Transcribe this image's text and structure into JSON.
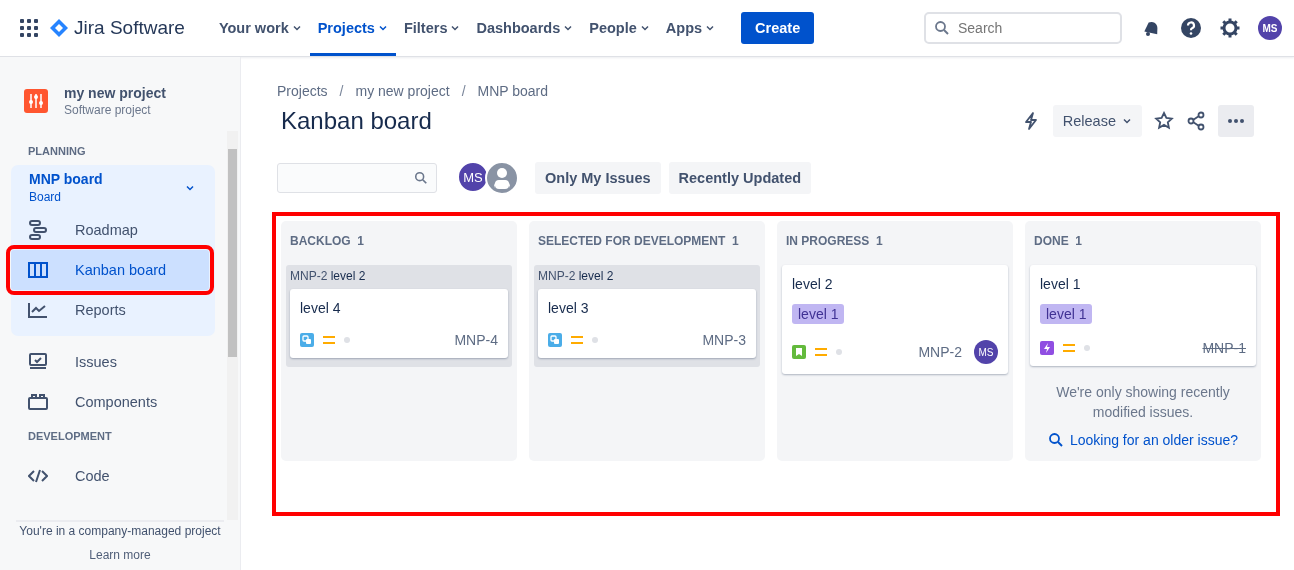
{
  "topnav": {
    "app_name": "Jira Software",
    "items": [
      {
        "label": "Your work",
        "selected": false
      },
      {
        "label": "Projects",
        "selected": true
      },
      {
        "label": "Filters",
        "selected": false
      },
      {
        "label": "Dashboards",
        "selected": false
      },
      {
        "label": "People",
        "selected": false
      },
      {
        "label": "Apps",
        "selected": false
      }
    ],
    "create": "Create",
    "search": {
      "placeholder": "Search"
    },
    "avatar": "MS"
  },
  "sidebar": {
    "project": {
      "name": "my new project",
      "type": "Software project"
    },
    "sections": [
      {
        "heading": "PLANNING",
        "board": {
          "name": "MNP board",
          "subtitle": "Board",
          "children": [
            {
              "label": "Roadmap",
              "kind": "roadmap",
              "selected": false,
              "highlighted": false
            },
            {
              "label": "Kanban board",
              "kind": "board",
              "selected": true,
              "highlighted": true
            },
            {
              "label": "Reports",
              "kind": "reports",
              "selected": false,
              "highlighted": false
            }
          ]
        },
        "items": [
          {
            "label": "Issues",
            "kind": "issues",
            "selected": false
          },
          {
            "label": "Components",
            "kind": "components",
            "selected": false
          }
        ]
      },
      {
        "heading": "DEVELOPMENT",
        "items": [
          {
            "label": "Code",
            "kind": "code",
            "selected": false
          }
        ]
      }
    ],
    "footer": {
      "text": "You're in a company-managed project",
      "link": "Learn more"
    }
  },
  "breadcrumbs": {
    "items": [
      "Projects",
      "my new project",
      "MNP board"
    ],
    "separator": "/"
  },
  "title": "Kanban board",
  "actions": {
    "release": "Release"
  },
  "filters": {
    "avatars": [
      {
        "kind": "initials",
        "text": "MS"
      },
      {
        "kind": "silhouette"
      }
    ],
    "quick_filters": [
      "Only My Issues",
      "Recently Updated"
    ]
  },
  "board": {
    "highlighted": true,
    "columns": [
      {
        "title": "BACKLOG",
        "count": "1",
        "groups": [
          {
            "parent_key": "MNP-2",
            "parent_summary": "level 2",
            "cards": [
              {
                "summary": "level 4",
                "kind": "subtask",
                "key": "MNP-4",
                "done": false
              }
            ]
          }
        ]
      },
      {
        "title": "SELECTED FOR DEVELOPMENT",
        "count": "1",
        "groups": [
          {
            "parent_key": "MNP-2",
            "parent_summary": "level 2",
            "cards": [
              {
                "summary": "level 3",
                "kind": "subtask",
                "key": "MNP-3",
                "done": false
              }
            ]
          }
        ]
      },
      {
        "title": "IN PROGRESS",
        "count": "1",
        "cards": [
          {
            "summary": "level 2",
            "label": "level 1",
            "kind": "story",
            "key": "MNP-2",
            "done": false,
            "assignee": "MS"
          }
        ]
      },
      {
        "title": "DONE",
        "count": "1",
        "cards": [
          {
            "summary": "level 1",
            "label": "level 1",
            "kind": "epic",
            "key": "MNP-1",
            "done": true
          }
        ],
        "note": "We're only showing recently modified issues.",
        "note_link": "Looking for an older issue?"
      }
    ]
  }
}
